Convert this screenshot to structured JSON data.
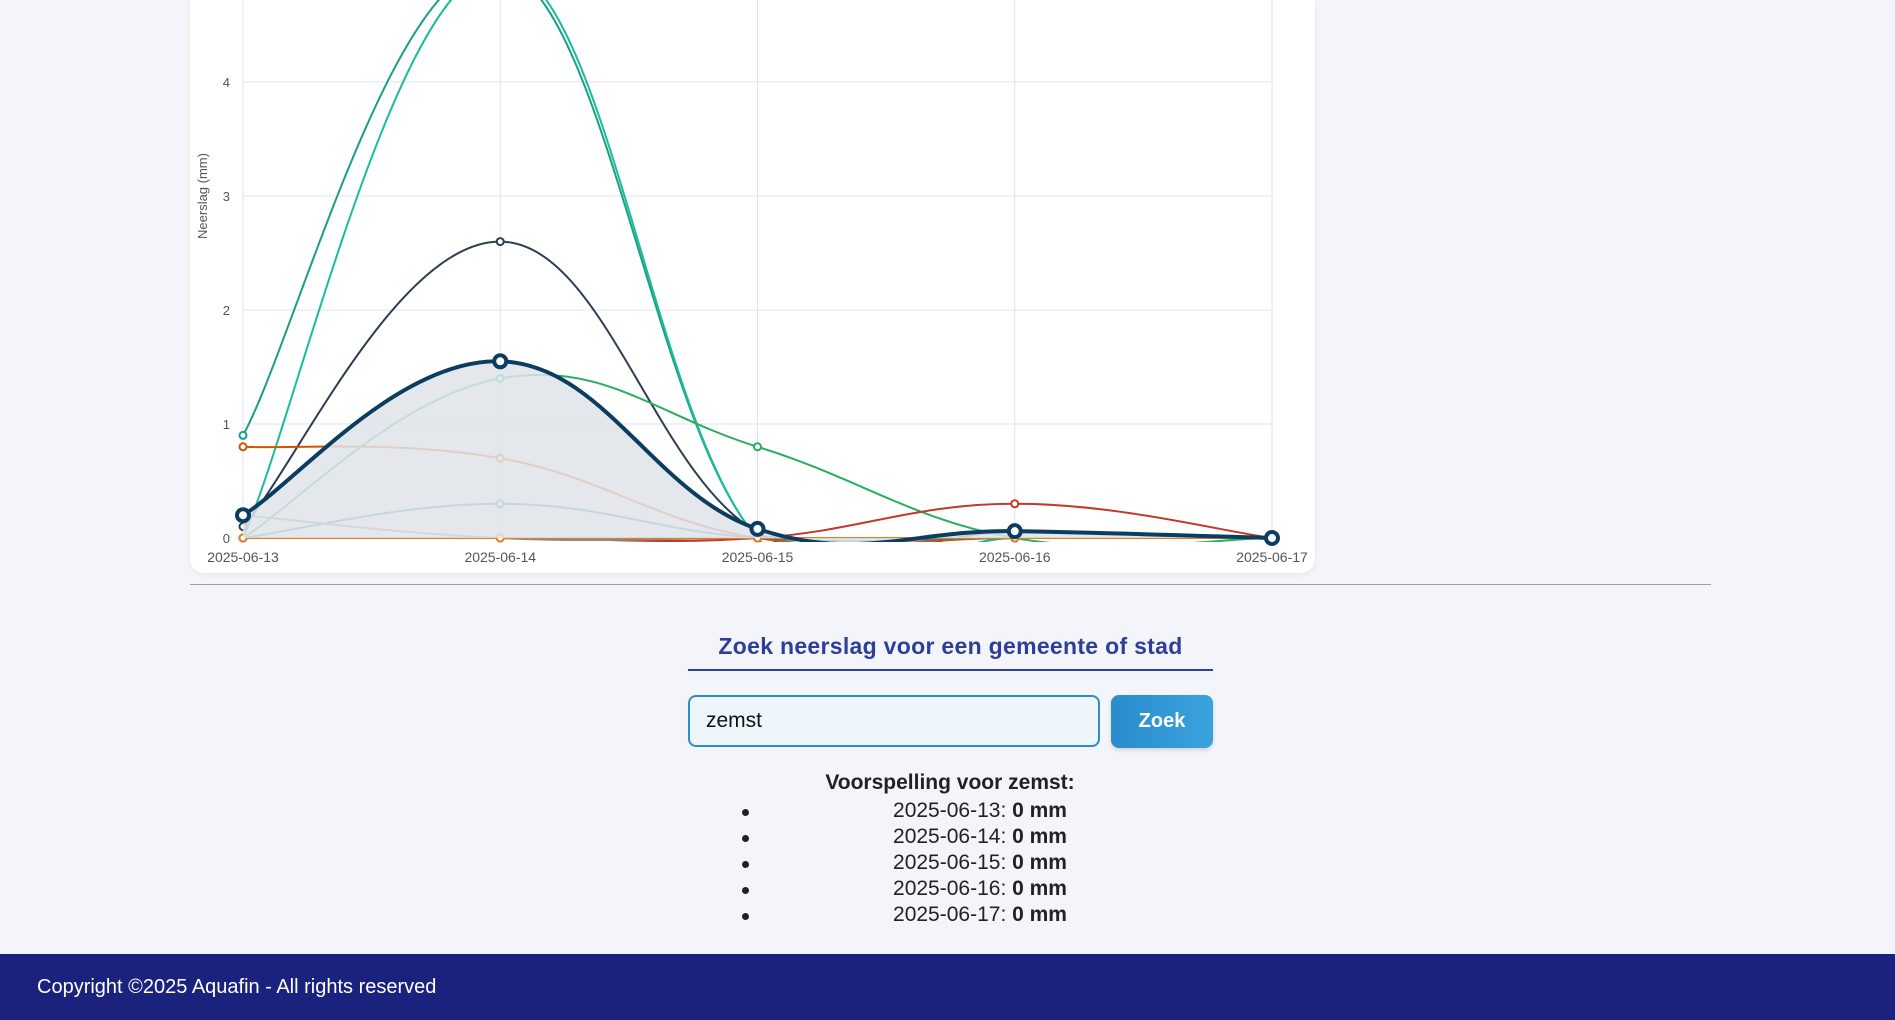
{
  "chart_data": {
    "type": "line",
    "ylabel": "Neerslag (mm)",
    "xlabel": "",
    "categories": [
      "2025-06-13",
      "2025-06-14",
      "2025-06-15",
      "2025-06-16",
      "2025-06-17"
    ],
    "ylim": [
      0,
      4.7
    ],
    "yticks": [
      0,
      1,
      2,
      3,
      4
    ],
    "grid": true,
    "series": [
      {
        "color": "#17a085",
        "values": [
          0.9,
          5.0,
          0.0,
          0.0,
          0.0
        ],
        "width": 2
      },
      {
        "color": "#1abc9c",
        "values": [
          0.0,
          5.0,
          0.0,
          0.0,
          0.0
        ],
        "width": 2
      },
      {
        "color": "#2c3e50",
        "values": [
          0.1,
          2.6,
          0.05,
          0.05,
          0.0
        ],
        "width": 2
      },
      {
        "color": "#27ae60",
        "values": [
          0.0,
          1.4,
          0.8,
          0.0,
          0.0
        ],
        "width": 2
      },
      {
        "color": "#d35400",
        "values": [
          0.8,
          0.7,
          0.0,
          0.0,
          0.0
        ],
        "width": 2
      },
      {
        "color": "#2980b9",
        "values": [
          0.0,
          0.3,
          0.0,
          0.0,
          0.0
        ],
        "width": 2
      },
      {
        "color": "#c0392b",
        "values": [
          0.0,
          0.0,
          0.0,
          0.3,
          0.0
        ],
        "width": 2
      },
      {
        "color": "#7f8c8d",
        "values": [
          0.2,
          0.0,
          0.0,
          0.0,
          0.0
        ],
        "width": 2
      },
      {
        "color": "#e67e22",
        "values": [
          0.0,
          0.0,
          0.0,
          0.0,
          0.0
        ],
        "width": 2
      },
      {
        "color": "#0b3d60",
        "values": [
          0.2,
          1.55,
          0.08,
          0.06,
          0.0
        ],
        "width": 4,
        "fill": "#dfe4ea"
      }
    ]
  },
  "search": {
    "title": "Zoek neerslag voor een gemeente of stad",
    "input_value": "zemst",
    "button_label": "Zoek"
  },
  "forecast": {
    "prefix": "Voorspelling voor",
    "municipality": "zemst",
    "suffix": ":",
    "items": [
      {
        "date": "2025-06-13",
        "sep": ": ",
        "amount": "0 mm"
      },
      {
        "date": "2025-06-14",
        "sep": ": ",
        "amount": "0 mm"
      },
      {
        "date": "2025-06-15",
        "sep": ": ",
        "amount": "0 mm"
      },
      {
        "date": "2025-06-16",
        "sep": ": ",
        "amount": "0 mm"
      },
      {
        "date": "2025-06-17",
        "sep": ": ",
        "amount": "0 mm"
      }
    ]
  },
  "footer": {
    "copyright": "Copyright ©2025 Aquafin - All rights reserved"
  }
}
